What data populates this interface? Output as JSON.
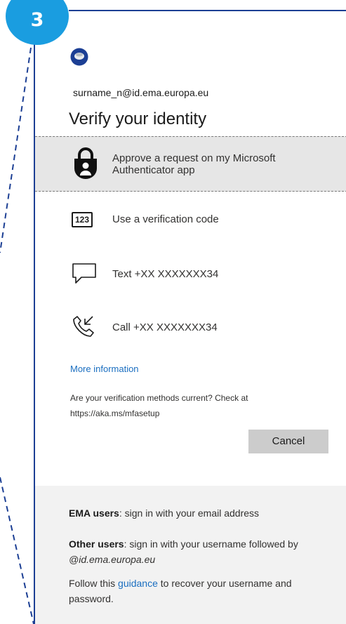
{
  "step": {
    "number": "3",
    "color": "#1a9de0"
  },
  "header": {
    "account": "surname_n@id.ema.europa.eu",
    "title": "Verify your identity",
    "logo_icon": "ema-logo-icon"
  },
  "methods": [
    {
      "icon": "authenticator-lock-icon",
      "label": "Approve a request on my Microsoft Authenticator app",
      "selected": true
    },
    {
      "icon": "verification-code-icon",
      "icon_text": "123",
      "label": "Use a verification code",
      "selected": false
    },
    {
      "icon": "chat-bubble-icon",
      "label": "Text +XX XXXXXXX34",
      "selected": false
    },
    {
      "icon": "phone-call-icon",
      "label": "Call +XX XXXXXXX34",
      "selected": false
    }
  ],
  "links": {
    "more_info": "More information"
  },
  "notice": "Are your verification methods current? Check at https://aka.ms/mfasetup",
  "buttons": {
    "cancel": "Cancel"
  },
  "info": {
    "ema_users_label": "EMA users",
    "ema_users_text": ": sign in with your email address",
    "other_users_label": "Other users",
    "other_users_text": ": sign in with your username followed by ",
    "other_users_domain": "@id.ema.europa.eu",
    "guidance_before": "Follow this ",
    "guidance_link": "guidance",
    "guidance_after": " to recover your username and password."
  },
  "colors": {
    "accent_line": "#1c3f94",
    "link": "#1a6ec0",
    "selected_bg": "#e6e6e6",
    "info_bg": "#f2f2f2"
  }
}
